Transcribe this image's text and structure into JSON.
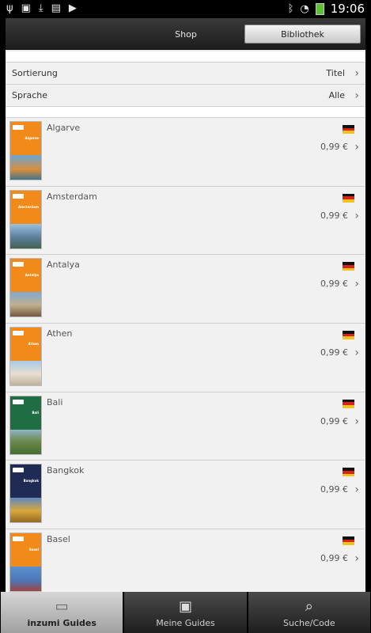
{
  "status_bar": {
    "left_icons": [
      "usb-icon",
      "image-icon",
      "download-icon",
      "bag-icon",
      "bag-play-icon"
    ],
    "right_icons": [
      "bluetooth-icon",
      "wifi-icon",
      "battery-icon"
    ],
    "time": "19:06"
  },
  "segmented": {
    "shop": "Shop",
    "library": "Bibliothek"
  },
  "settings": {
    "sort_label": "Sortierung",
    "sort_value": "Titel",
    "language_label": "Sprache",
    "language_value": "Alle"
  },
  "guides": [
    {
      "title": "Algarve",
      "price": "0,99 €"
    },
    {
      "title": "Amsterdam",
      "price": "0,99 €"
    },
    {
      "title": "Antalya",
      "price": "0,99 €"
    },
    {
      "title": "Athen",
      "price": "0,99 €"
    },
    {
      "title": "Bali",
      "price": "0,99 €"
    },
    {
      "title": "Bangkok",
      "price": "0,99 €"
    },
    {
      "title": "Basel",
      "price": "0,99 €"
    }
  ],
  "bottom_nav": {
    "tab1": "inzumi Guides",
    "tab2": "Meine Guides",
    "tab3": "Suche/Code"
  },
  "colors": {
    "cover_orange": "#f28a1a",
    "cover_green": "#1f6e43",
    "cover_navy": "#1f2a55"
  }
}
